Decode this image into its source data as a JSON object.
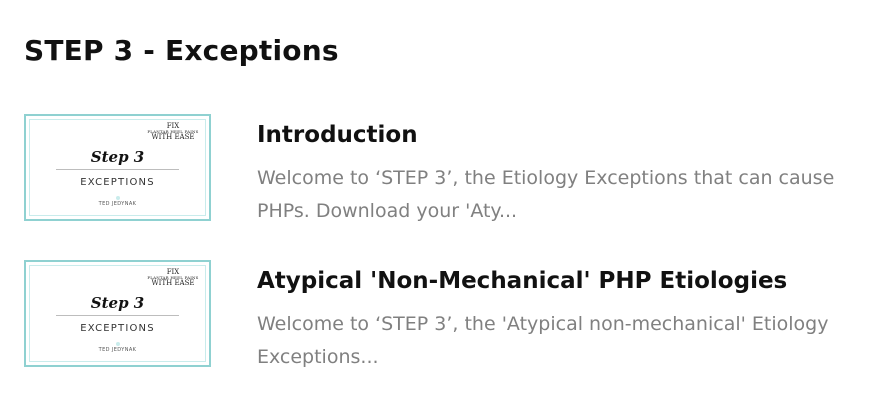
{
  "section": {
    "title": "STEP 3 - Exceptions"
  },
  "lessons": [
    {
      "title": "Introduction",
      "description": "Welcome to ‘STEP 3’, the Etiology Exceptions that can cause PHPs. Download your 'Aty...",
      "thumbnail": {
        "brand_line1": "FIX",
        "brand_line2": "PLANTAR HEEL PAINS",
        "brand_line3": "WITH EASE",
        "script_title": "Step 3",
        "caption": "EXCEPTIONS",
        "author": "TED JEDYNAK"
      }
    },
    {
      "title": "Atypical 'Non-Mechanical' PHP Etiologies",
      "description": "Welcome to ‘STEP 3’, the 'Atypical non-mechanical' Etiology Exceptions...",
      "thumbnail": {
        "brand_line1": "FIX",
        "brand_line2": "PLANTAR HEEL PAINS",
        "brand_line3": "WITH EASE",
        "script_title": "Step 3",
        "caption": "EXCEPTIONS",
        "author": "TED JEDYNAK"
      }
    }
  ],
  "colors": {
    "thumbnail_border": "#8fd1d1",
    "title_text": "#111111",
    "description_text": "#808080"
  }
}
